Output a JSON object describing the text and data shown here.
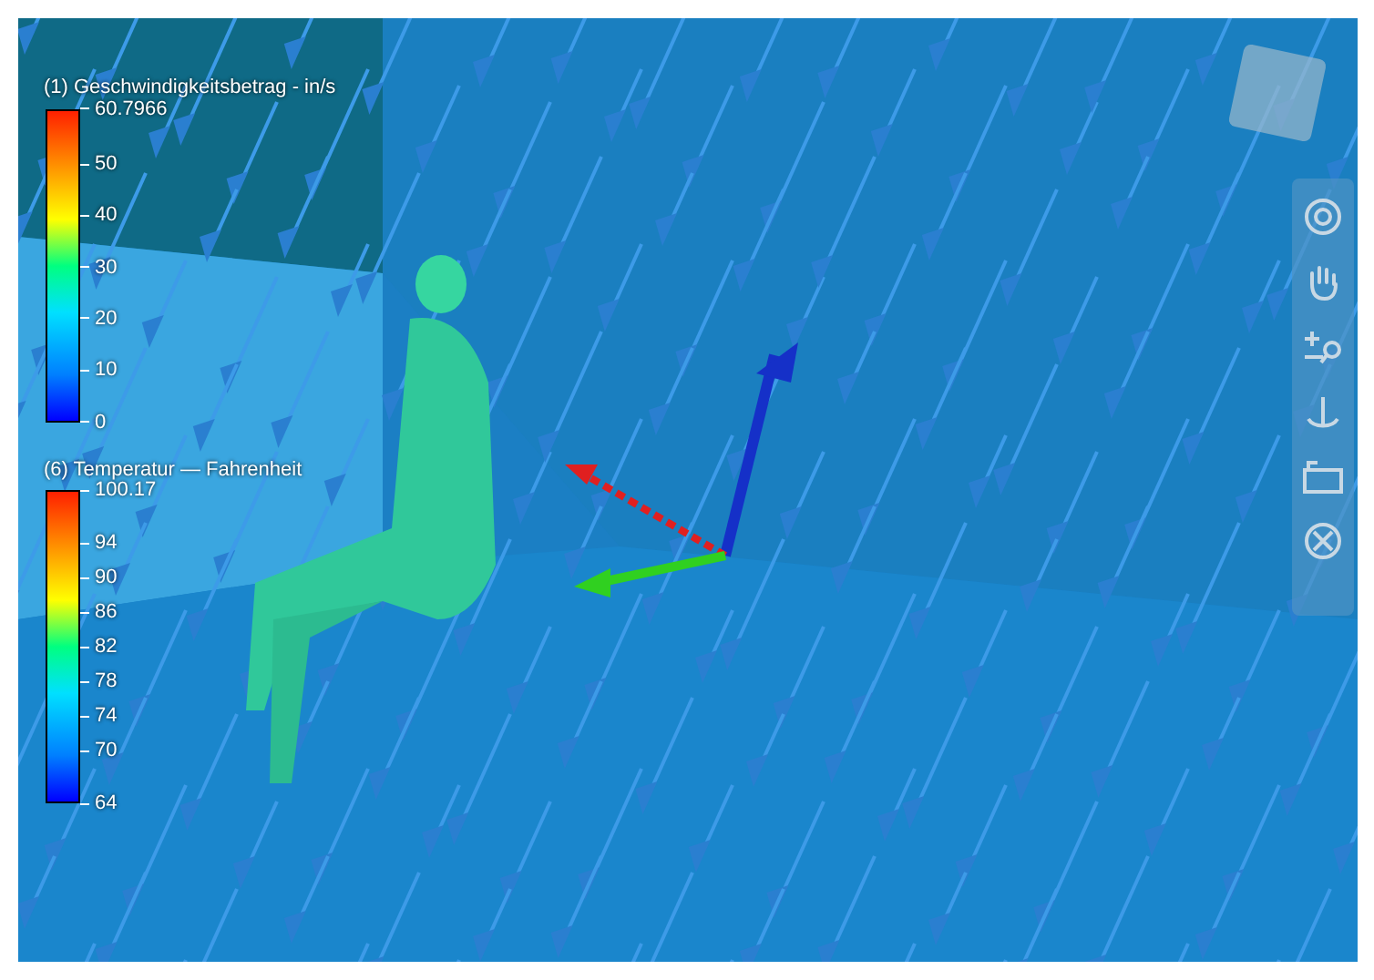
{
  "legends": [
    {
      "title": "(1) Geschwindigkeitsbetrag - in/s",
      "ticks": [
        "60.7966",
        "50",
        "40",
        "30",
        "20",
        "10",
        "0"
      ]
    },
    {
      "title": "(6) Temperatur — Fahrenheit",
      "ticks": [
        "100.17",
        "94",
        "90",
        "86",
        "82",
        "78",
        "74",
        "70",
        "64"
      ]
    }
  ]
}
